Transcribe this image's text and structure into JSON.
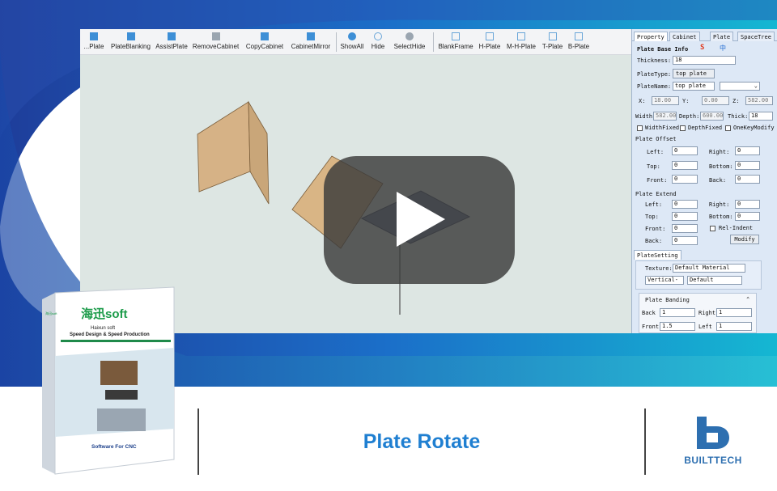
{
  "toolbar": {
    "items": [
      "...Plate",
      "PlateBlanking",
      "AssistPlate",
      "RemoveCabinet",
      "CopyCabinet",
      "CabinetMirror",
      "ShowAll",
      "Hide",
      "SelectHide",
      "BlankFrame",
      "H-Plate",
      "M-H-Plate",
      "T-Plate",
      "B-Plate"
    ]
  },
  "panel": {
    "tabs": [
      "Property",
      "Cabinet",
      "Plate",
      "SpaceTree"
    ],
    "base_info_header": "Plate Base Info",
    "thickness_label": "Thickness:",
    "thickness_value": "18",
    "platetype_label": "PlateType:",
    "platetype_value": "top plate",
    "platename_label": "PlateName:",
    "platename_value": "top plate",
    "x_label": "X:",
    "x_value": "18.00",
    "y_label": "Y:",
    "y_value": "0.00",
    "z_label": "Z:",
    "z_value": "582.00",
    "width_label": "Width:",
    "width_value": "582.00",
    "depth_label": "Depth:",
    "depth_value": "600.00",
    "thick_label": "Thick:",
    "thick_value": "18",
    "widthfixed_label": "WidthFixed",
    "depthfixed_label": "DepthFixed",
    "onekey_label": "OneKeyModify",
    "offset_header": "Plate Offset",
    "offset": {
      "left_label": "Left:",
      "left": "0",
      "right_label": "Right:",
      "right": "0",
      "top_label": "Top:",
      "top": "0",
      "bottom_label": "Bottom:",
      "bottom": "0",
      "front_label": "Front:",
      "front": "0",
      "back_label": "Back:",
      "back": "0"
    },
    "extend_header": "Plate Extend",
    "extend": {
      "left_label": "Left:",
      "left": "0",
      "right_label": "Right:",
      "right": "0",
      "top_label": "Top:",
      "top": "0",
      "bottom_label": "Bottom:",
      "bottom": "0",
      "front_label": "Front:",
      "front": "0",
      "back_label": "Back:",
      "back": "0"
    },
    "relindent_label": "Rel-Indent",
    "modify_label": "Modify",
    "platesetting_tab": "PlateSetting",
    "texture_label": "Texture:",
    "texture_value": "Default Material",
    "direction_value": "Vertical-",
    "default_value": "Default",
    "banding_header": "Plate Banding",
    "banding": {
      "back_label": "Back",
      "back": "1",
      "right_label": "Right",
      "right": "1",
      "front_label": "Front",
      "front": "1.5",
      "left_label": "Left",
      "left": "1"
    },
    "ime": {
      "s": "S",
      "zh": "中"
    }
  },
  "promo": {
    "title": "Plate Rotate",
    "brand": "BUILTTECH",
    "box_logo": "海迅soft",
    "box_sub1": "Haixun soft",
    "box_sub2": "Speed Design & Speed Production",
    "box_footer": "Software For CNC",
    "box_corner": "海迅soft"
  },
  "colors": {
    "accent": "#1f7fd1",
    "brand": "#2d6fb0",
    "wood": "#d6b286",
    "play_overlay": "#3a3a3a"
  }
}
